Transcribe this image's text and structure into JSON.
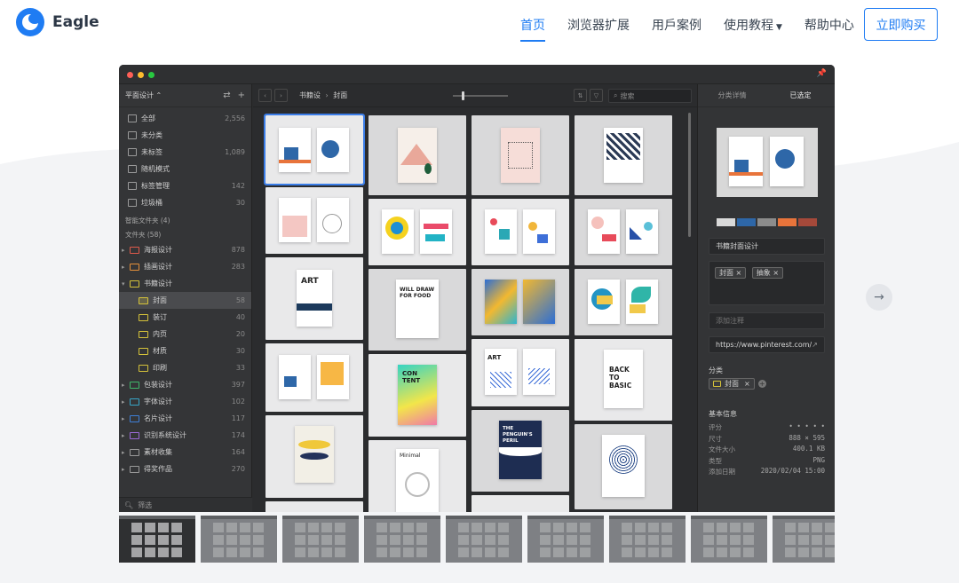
{
  "nav": {
    "brand": "Eagle",
    "links": [
      "首页",
      "浏览器扩展",
      "用戶案例",
      "使用教程",
      "帮助中心"
    ],
    "buy": "立即购买"
  },
  "sidebar": {
    "library": "平面设计 ⌃",
    "top": [
      {
        "label": "全部",
        "count": "2,556"
      },
      {
        "label": "未分类",
        "count": ""
      },
      {
        "label": "未标签",
        "count": "1,089"
      },
      {
        "label": "随机模式",
        "count": ""
      },
      {
        "label": "标签管理",
        "count": "142"
      },
      {
        "label": "垃圾桶",
        "count": "30"
      }
    ],
    "smart_folders": "智能文件夹 (4)",
    "folders_title": "文件夹 (58)",
    "folders": [
      {
        "label": "海报设计",
        "count": "878",
        "color": "#e05a4b",
        "sub": false
      },
      {
        "label": "插画设计",
        "count": "283",
        "color": "#e5903a",
        "sub": false
      },
      {
        "label": "书籍设计",
        "count": "",
        "color": "#d5c23a",
        "sub": false
      },
      {
        "label": "封面",
        "count": "58",
        "color": "#d5c23a",
        "sub": true
      },
      {
        "label": "装订",
        "count": "40",
        "color": "#d5c23a",
        "sub": true
      },
      {
        "label": "内页",
        "count": "20",
        "color": "#d5c23a",
        "sub": true
      },
      {
        "label": "材质",
        "count": "30",
        "color": "#d5c23a",
        "sub": true
      },
      {
        "label": "印刷",
        "count": "33",
        "color": "#d5c23a",
        "sub": true
      },
      {
        "label": "包装设计",
        "count": "397",
        "color": "#3fb86a",
        "sub": false
      },
      {
        "label": "字体设计",
        "count": "102",
        "color": "#37a6c9",
        "sub": false
      },
      {
        "label": "名片设计",
        "count": "117",
        "color": "#3e7fd8",
        "sub": false
      },
      {
        "label": "识别系统设计",
        "count": "174",
        "color": "#9b6ad8",
        "sub": false
      },
      {
        "label": "素材收集",
        "count": "164",
        "color": "#9a9a9a",
        "sub": false
      },
      {
        "label": "得奖作品",
        "count": "270",
        "color": "#9a9a9a",
        "sub": false
      }
    ],
    "filter": "筛选"
  },
  "toolbar": {
    "crumb_parent": "书籍设",
    "crumb_child": "封面",
    "search_placeholder": "搜索"
  },
  "inspector": {
    "tab1": "分类详情",
    "tab2": "已选定",
    "swatches": [
      "#d9d9d9",
      "#2e67a8",
      "#8c8c8c",
      "#e8743b",
      "#a5493a"
    ],
    "title": "书籍封面设计",
    "tags": [
      "封面 ×",
      "抽象 ×"
    ],
    "note_placeholder": "添加注释",
    "url": "https://www.pinterest.com/",
    "category_label": "分类",
    "category": "封面",
    "basic_info": "基本信息",
    "info": [
      {
        "k": "评分",
        "v": "• • • • •"
      },
      {
        "k": "尺寸",
        "v": "888 × 595"
      },
      {
        "k": "文件大小",
        "v": "400.1 KB"
      },
      {
        "k": "类型",
        "v": "PNG"
      },
      {
        "k": "添加日期",
        "v": "2020/02/04 15:00"
      }
    ]
  },
  "poster_texts": {
    "art": "ART",
    "will": "WILL DRAW FOR FOOD",
    "content": "CON TENT",
    "penguin": "THE PENGUIN'S PERIL",
    "back": "BACK TO BASIC",
    "minimal": "Minimal"
  }
}
